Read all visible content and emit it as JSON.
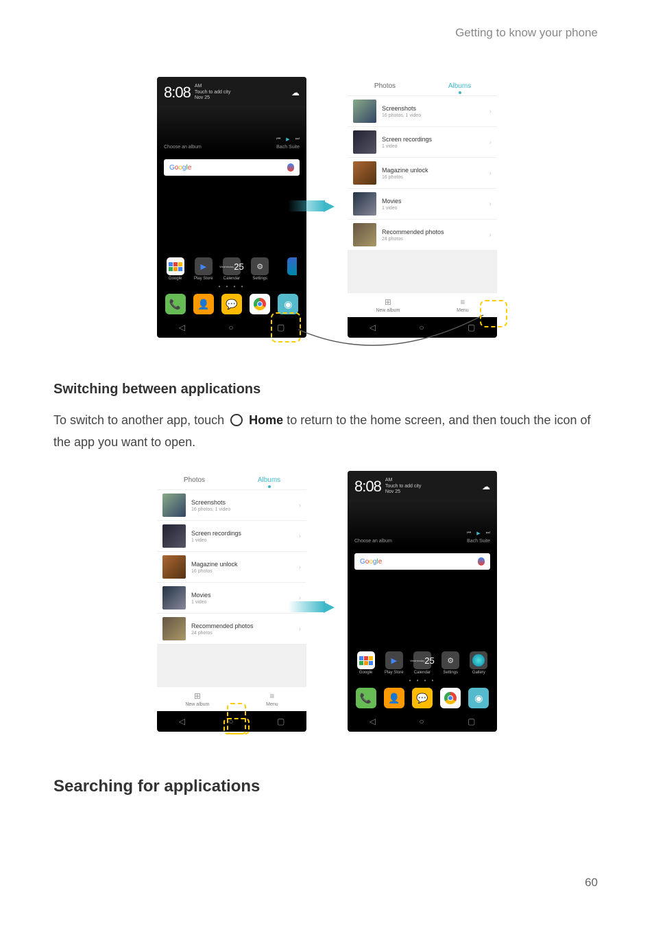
{
  "header": "Getting to know your phone",
  "page_number": "60",
  "headings": {
    "switch": "Switching between applications",
    "search": "Searching  for  applications"
  },
  "paragraph": {
    "pre": "To switch to another app, touch ",
    "home_label": "Home",
    "post": " to return to the home screen, and then touch the icon of the app you want to open."
  },
  "homescreen": {
    "time": "8:08",
    "ampm": "AM",
    "addcity": "Touch to add city",
    "date": "Nov 25",
    "choose_album": "Choose an album",
    "track": "Bach Suite",
    "google_letters": [
      "G",
      "o",
      "o",
      "g",
      "l",
      "e"
    ],
    "google_colors": [
      "#4285f4",
      "#ea4335",
      "#fbbc05",
      "#4285f4",
      "#34a853",
      "#ea4335"
    ],
    "apps": [
      {
        "label": "Google"
      },
      {
        "label": "Play Store"
      },
      {
        "label": "Calendar",
        "day": "Wednesday",
        "num": "25"
      },
      {
        "label": "Settings"
      },
      {
        "label": "Gallery"
      }
    ],
    "dots": "• • • •"
  },
  "gallery": {
    "tab_photos": "Photos",
    "tab_albums": "Albums",
    "albums": [
      {
        "name": "Screenshots",
        "count": "16 photos, 1 video",
        "t": "t1"
      },
      {
        "name": "Screen recordings",
        "count": "1 video",
        "t": "t2"
      },
      {
        "name": "Magazine unlock",
        "count": "16 photos",
        "t": "t3"
      },
      {
        "name": "Movies",
        "count": "1 video",
        "t": "t4"
      },
      {
        "name": "Recommended photos",
        "count": "24 photos",
        "t": "t5"
      }
    ],
    "new_album": "New album",
    "menu": "Menu"
  }
}
